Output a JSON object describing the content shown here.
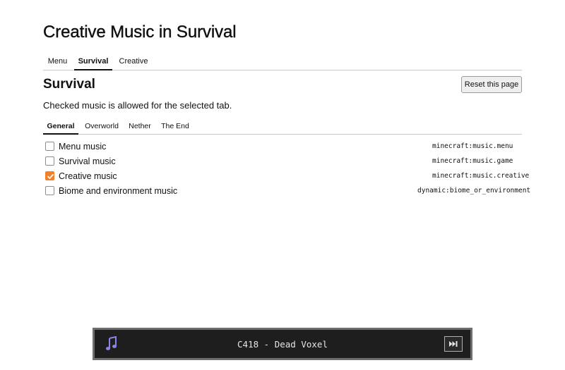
{
  "page_title": "Creative Music in Survival",
  "top_tabs": [
    {
      "label": "Menu",
      "active": false
    },
    {
      "label": "Survival",
      "active": true
    },
    {
      "label": "Creative",
      "active": false
    }
  ],
  "section": {
    "title": "Survival",
    "reset_label": "Reset this page",
    "description": "Checked music is allowed for the selected tab."
  },
  "sub_tabs": [
    {
      "label": "General",
      "active": true
    },
    {
      "label": "Overworld",
      "active": false
    },
    {
      "label": "Nether",
      "active": false
    },
    {
      "label": "The End",
      "active": false
    }
  ],
  "music_items": [
    {
      "label": "Menu music",
      "id": "minecraft:music.menu",
      "checked": false
    },
    {
      "label": "Survival music",
      "id": "minecraft:music.game",
      "checked": false
    },
    {
      "label": "Creative music",
      "id": "minecraft:music.creative",
      "checked": true
    },
    {
      "label": "Biome and environment music",
      "id": "dynamic:biome_or_environment",
      "checked": false
    }
  ],
  "player": {
    "icon": "music-note-icon",
    "track": "C418 - Dead Voxel",
    "skip_icon": "skip-forward-icon"
  },
  "colors": {
    "accent": "#f0802a",
    "player_background": "#1e1e1e",
    "note_icon": "#8d84e8"
  }
}
